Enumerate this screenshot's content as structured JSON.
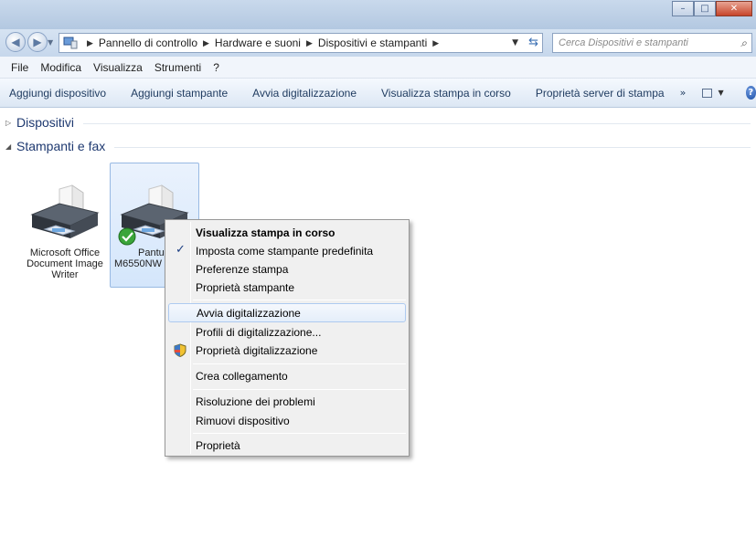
{
  "window": {
    "minimize_glyph": "–",
    "maximize_glyph": "□",
    "close_glyph": "✕"
  },
  "address": {
    "crumbs": [
      "Pannello di controllo",
      "Hardware e suoni",
      "Dispositivi e stampanti"
    ],
    "search_placeholder": "Cerca Dispositivi e stampanti"
  },
  "menubar": {
    "items": [
      "File",
      "Modifica",
      "Visualizza",
      "Strumenti",
      "?"
    ]
  },
  "commandbar": {
    "items": [
      "Aggiungi dispositivo",
      "Aggiungi stampante",
      "Avvia digitalizzazione",
      "Visualizza stampa in corso",
      "Proprietà server di stampa"
    ],
    "more": "»"
  },
  "groups": {
    "devices": "Dispositivi",
    "printers": "Stampanti e fax"
  },
  "printers": [
    {
      "label_lines": [
        "Microsoft Office",
        "Document Image",
        "Writer"
      ]
    },
    {
      "label_lines": [
        "Pantu",
        "M6550NW"
      ]
    }
  ],
  "context_menu": {
    "items": [
      "Visualizza stampa in corso",
      "Imposta come stampante predefinita",
      "Preferenze stampa",
      "Proprietà stampante",
      "Avvia digitalizzazione",
      "Profili di digitalizzazione...",
      "Proprietà digitalizzazione",
      "Crea collegamento",
      "Risoluzione dei problemi",
      "Rimuovi dispositivo",
      "Proprietà"
    ]
  },
  "colors": {
    "accent": "#1e3970",
    "selection": "#d4e6fb",
    "close_button": "#c7452a"
  }
}
